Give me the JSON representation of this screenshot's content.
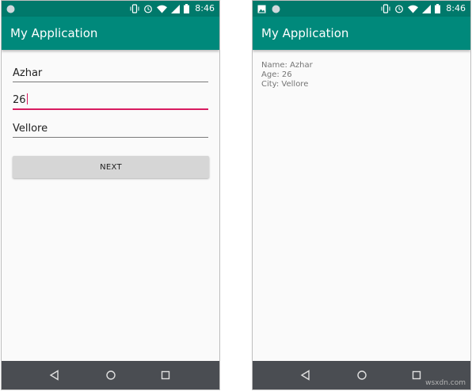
{
  "colors": {
    "status_bar": "#00796b",
    "app_bar": "#00897b",
    "accent": "#d81b60",
    "nav_bar": "#4a4d52",
    "screen_bg": "#fafafa"
  },
  "left_screen": {
    "status": {
      "time": "8:46",
      "icons": [
        "circle-notification-icon",
        "vibrate-icon",
        "alarm-icon",
        "wifi-icon",
        "signal-icon",
        "battery-icon"
      ]
    },
    "app_title": "My Application",
    "fields": [
      {
        "value": "Azhar",
        "focused": false
      },
      {
        "value": "26",
        "focused": true
      },
      {
        "value": "Vellore",
        "focused": false
      }
    ],
    "next_label": "NEXT"
  },
  "right_screen": {
    "status": {
      "time": "8:46",
      "icons": [
        "image-notification-icon",
        "circle-notification-icon",
        "vibrate-icon",
        "alarm-icon",
        "wifi-icon",
        "signal-icon",
        "battery-icon"
      ]
    },
    "app_title": "My Application",
    "details": {
      "name": "Name: Azhar",
      "age": "Age: 26",
      "city": "City: Vellore"
    }
  },
  "navigation": [
    "back-icon",
    "home-icon",
    "recents-icon"
  ],
  "watermark": "wsxdn.com"
}
